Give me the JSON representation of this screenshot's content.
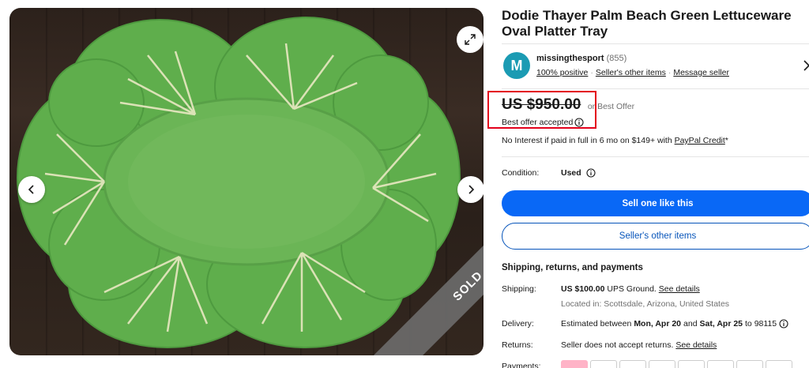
{
  "listing": {
    "title": "Dodie Thayer Palm Beach Green Lettuceware Oval Platter Tray",
    "sold_badge": "SOLD"
  },
  "seller": {
    "avatar_letter": "M",
    "name": "missingthesport",
    "feedback_count": "(855)",
    "positive": "100% positive",
    "other_items": "Seller's other items",
    "message": "Message seller",
    "sep": "·"
  },
  "price": {
    "amount": "US $950.00",
    "or_best_offer": "or Best Offer",
    "best_offer_accepted": "Best offer accepted",
    "paypal_prefix": "No Interest if paid in full in 6 mo on $149+ with",
    "paypal_link": "PayPal Credit",
    "paypal_suffix": "*"
  },
  "condition": {
    "label": "Condition:",
    "value": "Used"
  },
  "buttons": {
    "sell_one": "Sell one like this",
    "sellers_other_items": "Seller's other items"
  },
  "shipping": {
    "heading": "Shipping, returns, and payments",
    "shipping_label": "Shipping:",
    "shipping_value": "US $100.00",
    "shipping_method": "UPS Ground.",
    "see_details": "See details",
    "located": "Located in: Scottsdale, Arizona, United States",
    "delivery_label": "Delivery:",
    "delivery_prefix": "Estimated between",
    "delivery_from": "Mon, Apr 20",
    "delivery_and": "and",
    "delivery_to": "Sat, Apr 25",
    "delivery_suffix": "to 98115",
    "returns_label": "Returns:",
    "returns_value": "Seller does not accept returns.",
    "returns_link": "See details",
    "payments_label": "Payments:"
  },
  "colors": {
    "primary_blue": "#0968f6",
    "link_blue": "#0654ba",
    "highlight_red": "#e3001b",
    "avatar_teal": "#1b9bb3"
  }
}
